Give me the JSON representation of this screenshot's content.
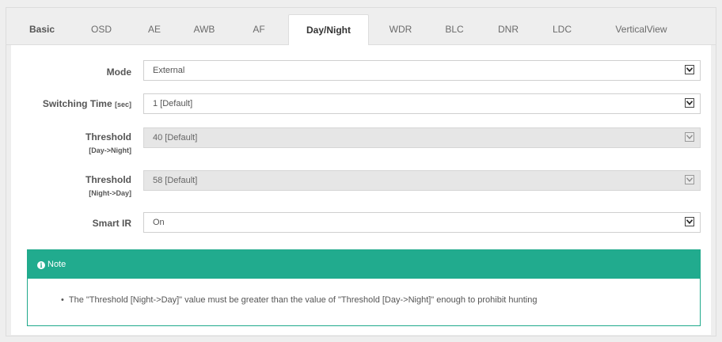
{
  "tabs": [
    {
      "label": "Basic"
    },
    {
      "label": "OSD"
    },
    {
      "label": "AE"
    },
    {
      "label": "AWB"
    },
    {
      "label": "AF"
    },
    {
      "label": "Day/Night"
    },
    {
      "label": "WDR"
    },
    {
      "label": "BLC"
    },
    {
      "label": "DNR"
    },
    {
      "label": "LDC"
    },
    {
      "label": "VerticalView"
    }
  ],
  "form": {
    "mode": {
      "label": "Mode",
      "value": "External"
    },
    "switching_time": {
      "label": "Switching Time",
      "unit": "[sec]",
      "value": "1  [Default]"
    },
    "threshold_day_night": {
      "label": "Threshold",
      "sub": "[Day->Night]",
      "value": "40 [Default]"
    },
    "threshold_night_day": {
      "label": "Threshold",
      "sub": "[Night->Day]",
      "value": "58 [Default]"
    },
    "smart_ir": {
      "label": "Smart IR",
      "value": "On"
    }
  },
  "note": {
    "title": "Note",
    "text": "The \"Threshold [Night->Day]\" value must be greater than the value of \"Threshold [Day->Night]\" enough to prohibit hunting"
  }
}
